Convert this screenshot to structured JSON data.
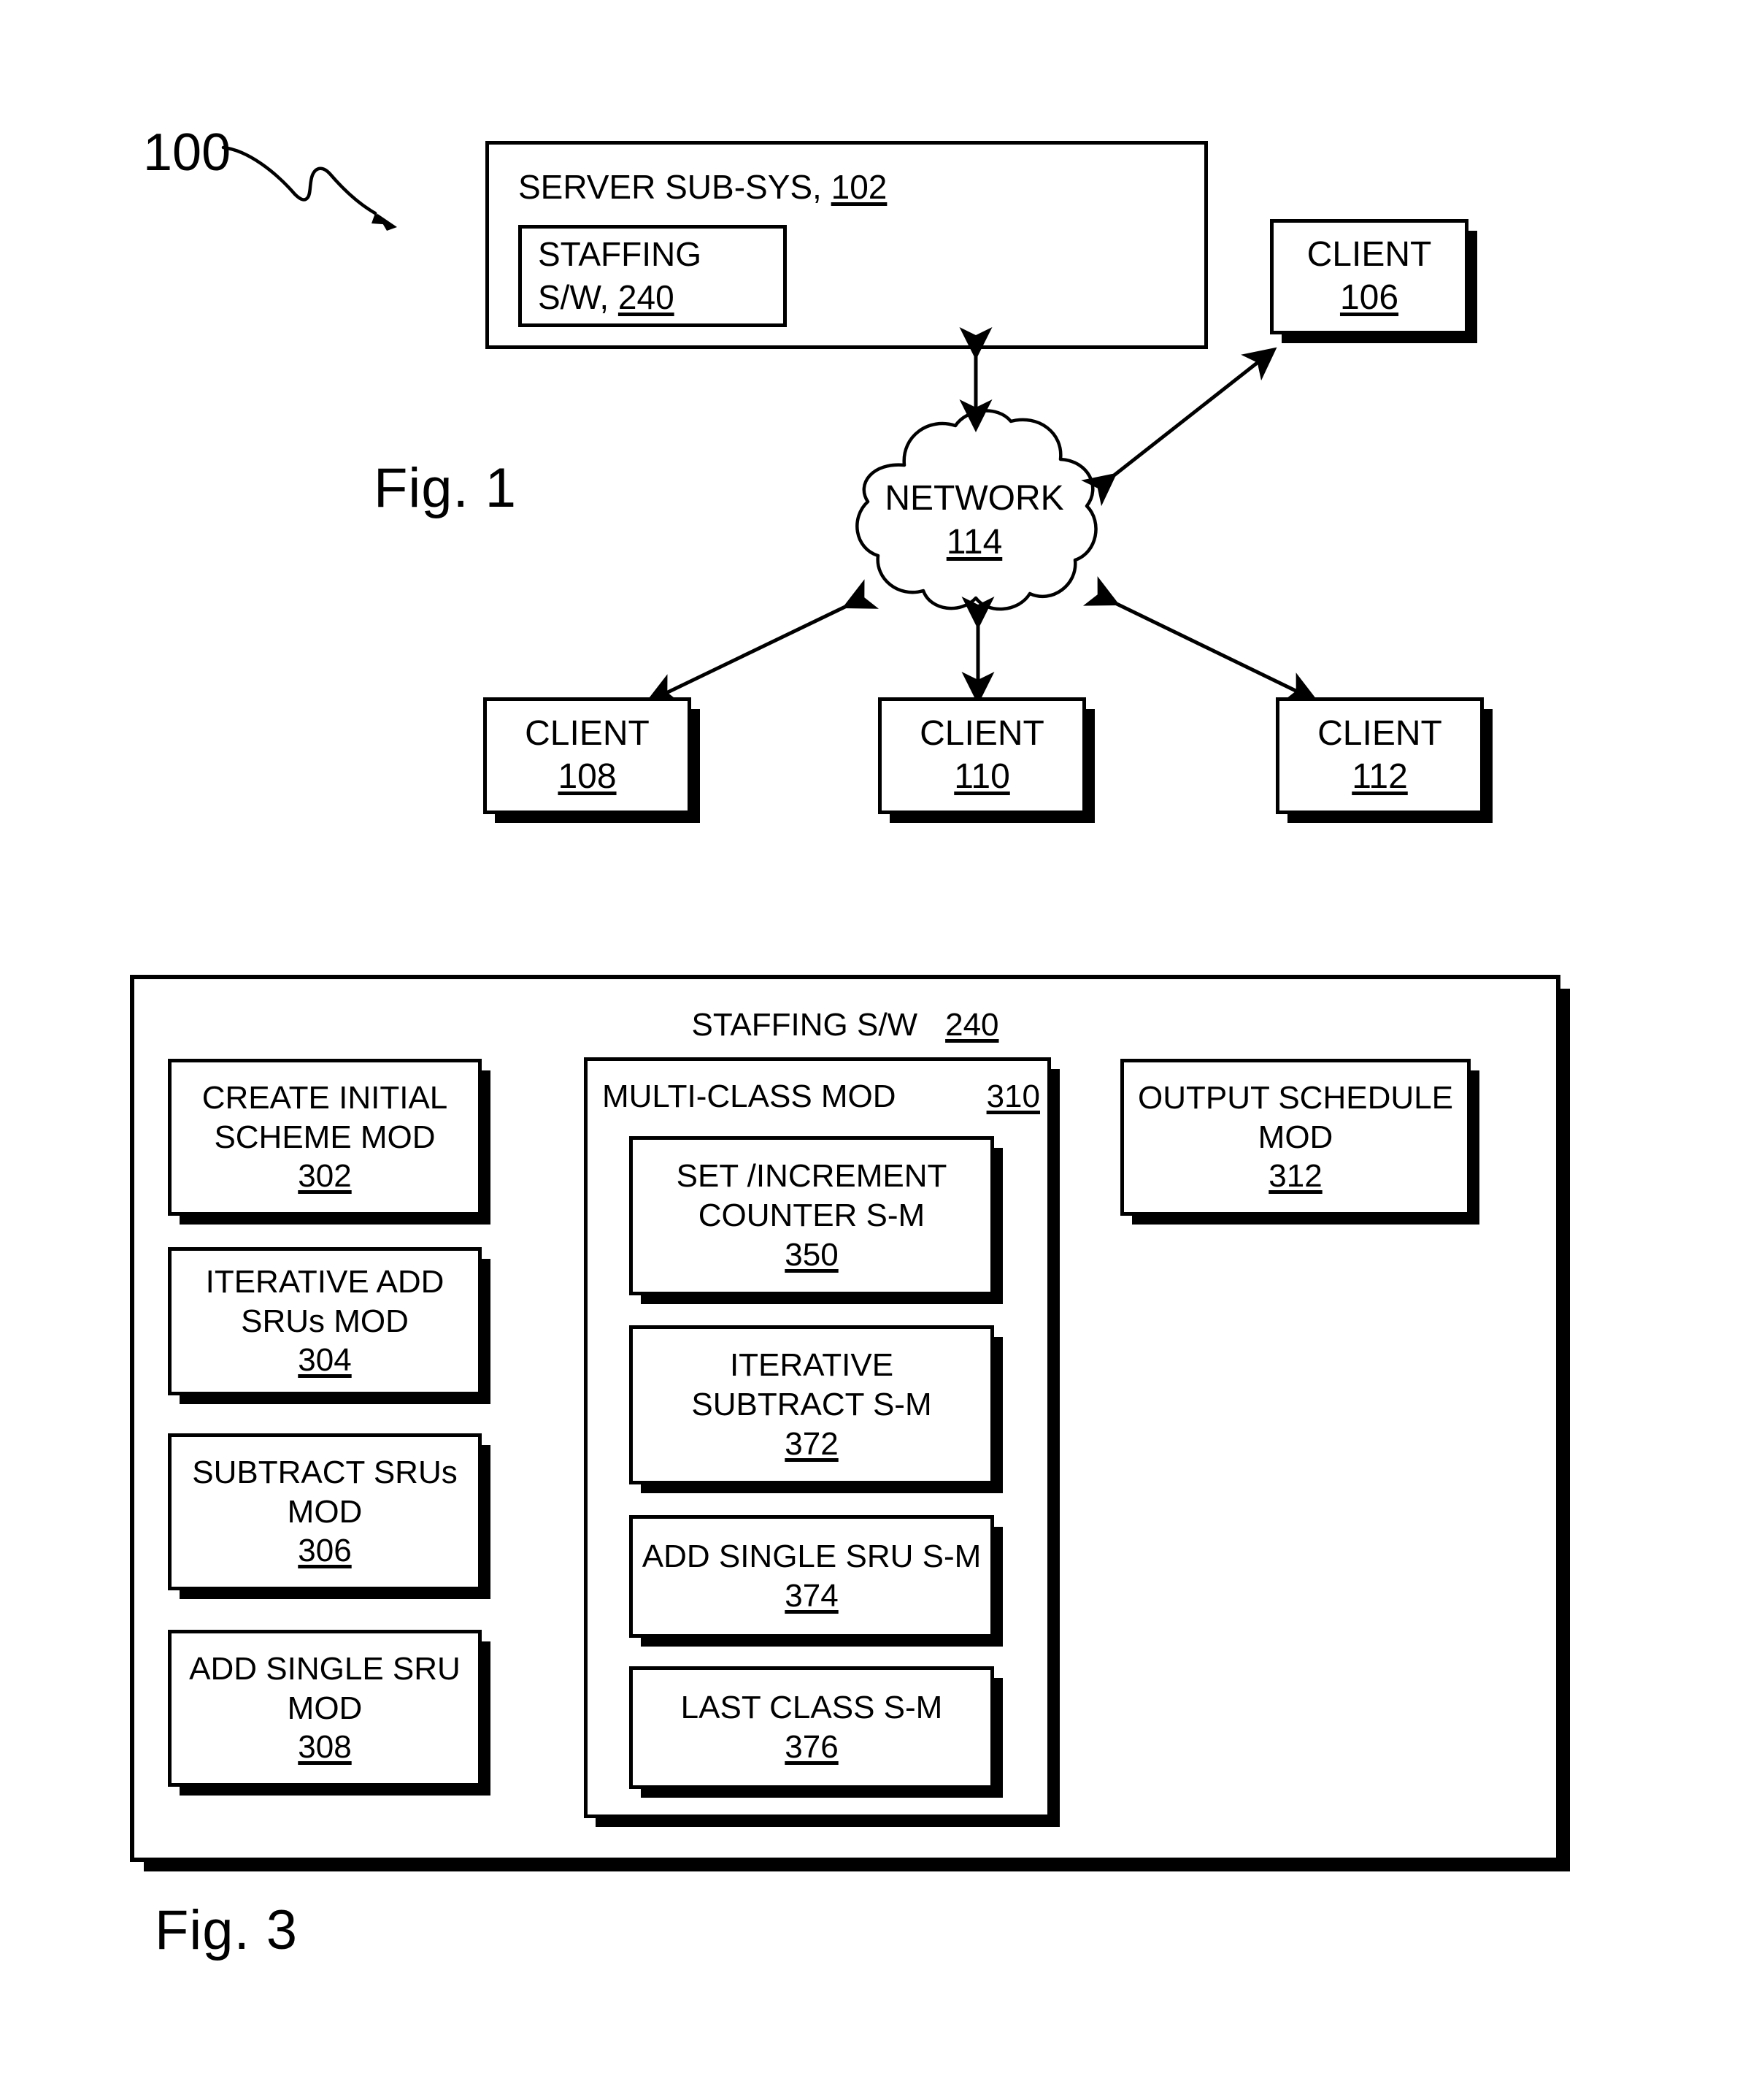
{
  "figure1": {
    "caption": "Fig. 1",
    "system_ref": "100",
    "server": {
      "title_text": "SERVER SUB-SYS, ",
      "title_ref": "102",
      "staffing_sw": {
        "line1": "STAFFING",
        "line2": "S/W, ",
        "ref": "240"
      }
    },
    "network": {
      "label": "NETWORK",
      "ref": "114"
    },
    "clients": [
      {
        "label": "CLIENT",
        "ref": "106"
      },
      {
        "label": "CLIENT",
        "ref": "108"
      },
      {
        "label": "CLIENT",
        "ref": "110"
      },
      {
        "label": "CLIENT",
        "ref": "112"
      }
    ]
  },
  "figure3": {
    "caption": "Fig. 3",
    "title": "STAFFING S/W",
    "title_ref": "240",
    "left_modules": [
      {
        "line1": "CREATE INITIAL",
        "line2": "SCHEME MOD",
        "ref": "302"
      },
      {
        "line1": "ITERATIVE ADD",
        "line2": "SRUs MOD",
        "ref": "304"
      },
      {
        "line1": "SUBTRACT SRUs",
        "line2": "MOD",
        "ref": "306"
      },
      {
        "line1": "ADD SINGLE SRU",
        "line2": "MOD",
        "ref": "308"
      }
    ],
    "multi_class": {
      "title": "MULTI-CLASS MOD",
      "ref": "310",
      "sub_modules": [
        {
          "line1": "SET /INCREMENT",
          "line2": "COUNTER S-M",
          "ref": "350"
        },
        {
          "line1": "ITERATIVE",
          "line2": "SUBTRACT S-M",
          "ref": "372"
        },
        {
          "line1": "ADD SINGLE SRU S-M",
          "line2": "",
          "ref": "374"
        },
        {
          "line1": "LAST CLASS S-M",
          "line2": "",
          "ref": "376"
        }
      ]
    },
    "right_module": {
      "line1": "OUTPUT SCHEDULE",
      "line2": "MOD",
      "ref": "312"
    }
  },
  "colors": {
    "ink": "#000000",
    "paper": "#ffffff"
  }
}
